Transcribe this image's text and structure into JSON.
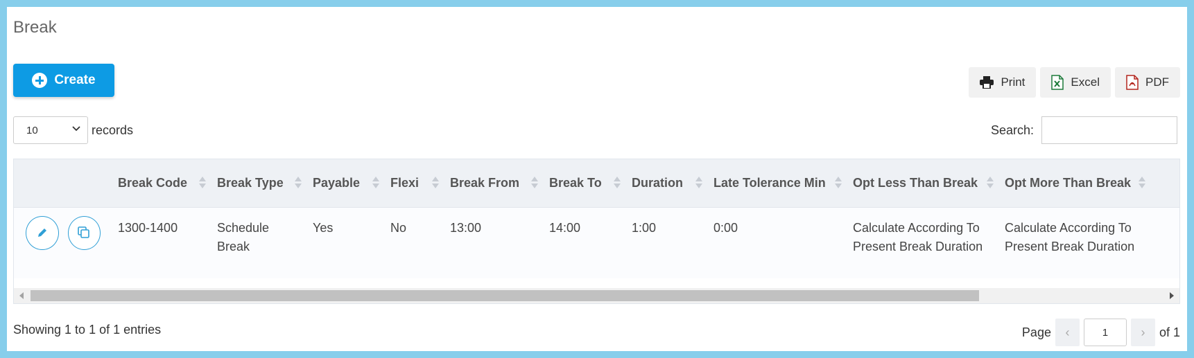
{
  "page": {
    "title": "Break"
  },
  "toolbar": {
    "create_label": "Create",
    "print_label": "Print",
    "excel_label": "Excel",
    "pdf_label": "PDF"
  },
  "length": {
    "selected": "10",
    "label": "records"
  },
  "search": {
    "label": "Search:",
    "value": ""
  },
  "table": {
    "columns": [
      "Break Code",
      "Break Type",
      "Payable",
      "Flexi",
      "Break From",
      "Break To",
      "Duration",
      "Late Tolerance Min",
      "Opt Less Than Break",
      "Opt More Than Break"
    ],
    "rows": [
      {
        "break_code": "1300-1400",
        "break_type_1": "Schedule",
        "break_type_2": "Break",
        "payable": "Yes",
        "flexi": "No",
        "break_from": "13:00",
        "break_to": "14:00",
        "duration": "1:00",
        "late_tolerance": "0:00",
        "opt_less_1": "Calculate According To",
        "opt_less_2": "Present Break Duration",
        "opt_more_1": "Calculate According To",
        "opt_more_2": "Present Break Duration"
      }
    ]
  },
  "footer": {
    "info": "Showing 1 to 1 of 1 entries",
    "page_label": "Page",
    "page_value": "1",
    "of_label": "of 1",
    "prev": "‹",
    "next": "›"
  },
  "colors": {
    "primary": "#0d9be4",
    "background": "#87ceeb"
  }
}
